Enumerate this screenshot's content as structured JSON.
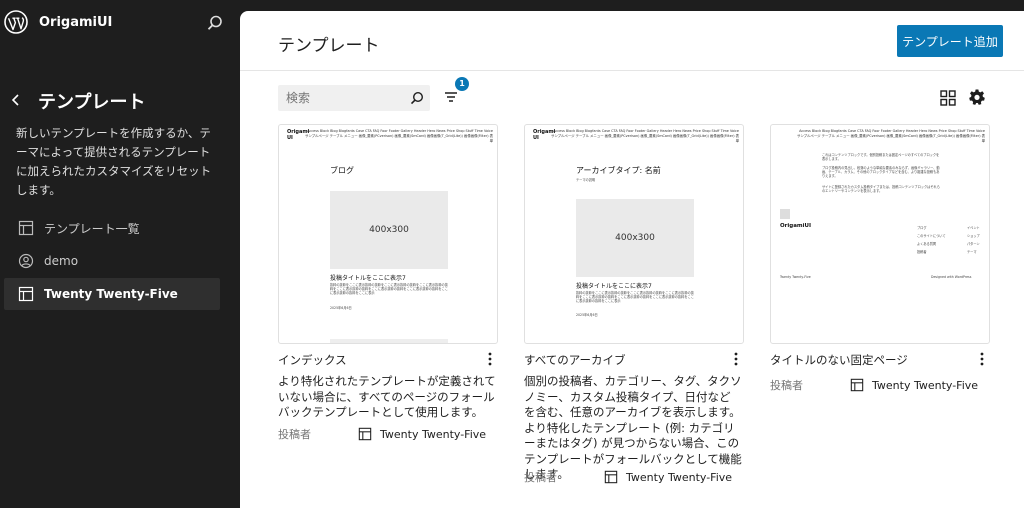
{
  "site": {
    "name": "OrigamiUI"
  },
  "sidebar": {
    "title": "テンプレート",
    "description": "新しいテンプレートを作成するか、テーマによって提供されるテンプレートに加えられたカスタマイズをリセットします。",
    "items": [
      {
        "label": "テンプレート一覧",
        "icon": "layout-icon"
      },
      {
        "label": "demo",
        "icon": "user-circle-icon"
      },
      {
        "label": "Twenty Twenty-Five",
        "icon": "layout-icon",
        "active": true
      }
    ]
  },
  "main": {
    "title": "テンプレート",
    "add_button": "テンプレート追加",
    "search_placeholder": "検索",
    "filter_count": "1"
  },
  "cards": [
    {
      "title": "インデックス",
      "description": "より特化されたテンプレートが定義されていない場合に、すべてのページのフォールバックテンプレートとして使用します。",
      "author_label": "投稿者",
      "author": "Twenty Twenty-Five",
      "thumb": {
        "logo": "Origami UI",
        "nav": "Access Block Blog Blogfants Case CTA FAQ Foor Footer Gallery Header Hero News Price Shop Stuff Time Voice サンプルページ テーブル メニュー 画像_要素(PCverison) 画像_要素(SmCard) 画像画像(T_Grid(Lite)) 画像画像(Filter) 表単",
        "heading": "ブログ",
        "placeholder": "400x300",
        "post_title": "投稿タイトルをここに表示7",
        "excerpt": "抜粋の抜粋をここに表示抜粋の抜粋をここに表示抜粋の抜粋をここに表示抜粋の抜粋をここに表示抜粋の抜粋をここに表示抜粋の抜粋をここに表示抜粋の抜粋をここに表示抜粋の抜粋をここに表示",
        "date": "2025年6月6日"
      }
    },
    {
      "title": "すべてのアーカイブ",
      "description": "個別の投稿者、カテゴリー、タグ、タクソノミー、カスタム投稿タイプ、日付などを含む、任意のアーカイブを表示します。より特化したテンプレート (例: カテゴリーまたはタグ) が見つからない場合、このテンプレートがフォールバックとして機能します。",
      "author_label": "投稿者",
      "author": "Twenty Twenty-Five",
      "thumb": {
        "logo": "Origami UI",
        "nav": "Access Block Blog Blogfants Case CTA FAQ Foor Footer Gallery Header Hero News Price Shop Stuff Time Voice サンプルページ テーブル メニュー 画像_要素(PCverison) 画像_要素(SmCard) 画像画像(T_Grid(Lite)) 画像画像(Filter) 表単",
        "heading": "アーカイブタイプ: 名前",
        "subheading": "テーマの説明",
        "placeholder": "400x300",
        "post_title": "投稿タイトルをここに表示7",
        "excerpt": "抜粋の抜粋をここに表示抜粋の抜粋をここに表示抜粋の抜粋をここに表示抜粋の抜粋をここに表示抜粋の抜粋をここに表示抜粋の抜粋をここに表示抜粋の抜粋をここに表示抜粋の抜粋をここに表示",
        "date": "2025年6月6日"
      }
    },
    {
      "title": "タイトルのない固定ページ",
      "author_label": "投稿者",
      "author": "Twenty Twenty-Five",
      "thumb": {
        "nav": "Access Block Blog Blogfants Case CTA FAQ Foor Footer Gallery Header Hero News Price Shop Stuff Time Voice サンプルページ テーブル メニュー 画像_要素(PCverison) 画像_要素(SmCard) 画像画像(T_Grid(Lite)) 画像画像(Filter) 表単",
        "text1": "これはコンテンツブロックです。個別投稿または固定ページのすべてのブロックを表示します。",
        "text2": "ブログ投稿内の見出し、段落のような単純な要素のみならず、画像ギャラリー、動画、テーブル、カラム、その他のブロックタイプなどを含む、より複雑な投稿もありえます。",
        "text3": "サイトに登録されたカスタム投稿タイプまたは、投稿コンテンツブロックはそれらのエントリーやコンテンツを表示します。",
        "footer_logo": "OrigamiUI",
        "links_left": [
          "ブログ",
          "このサイトについて",
          "よくある質問",
          "投稿者"
        ],
        "links_right": [
          "イベント",
          "ショップ",
          "パターン",
          "テーマ"
        ],
        "footer_left": "Twenty Twenty-Five",
        "footer_right": "Designed with WordPress"
      }
    }
  ]
}
